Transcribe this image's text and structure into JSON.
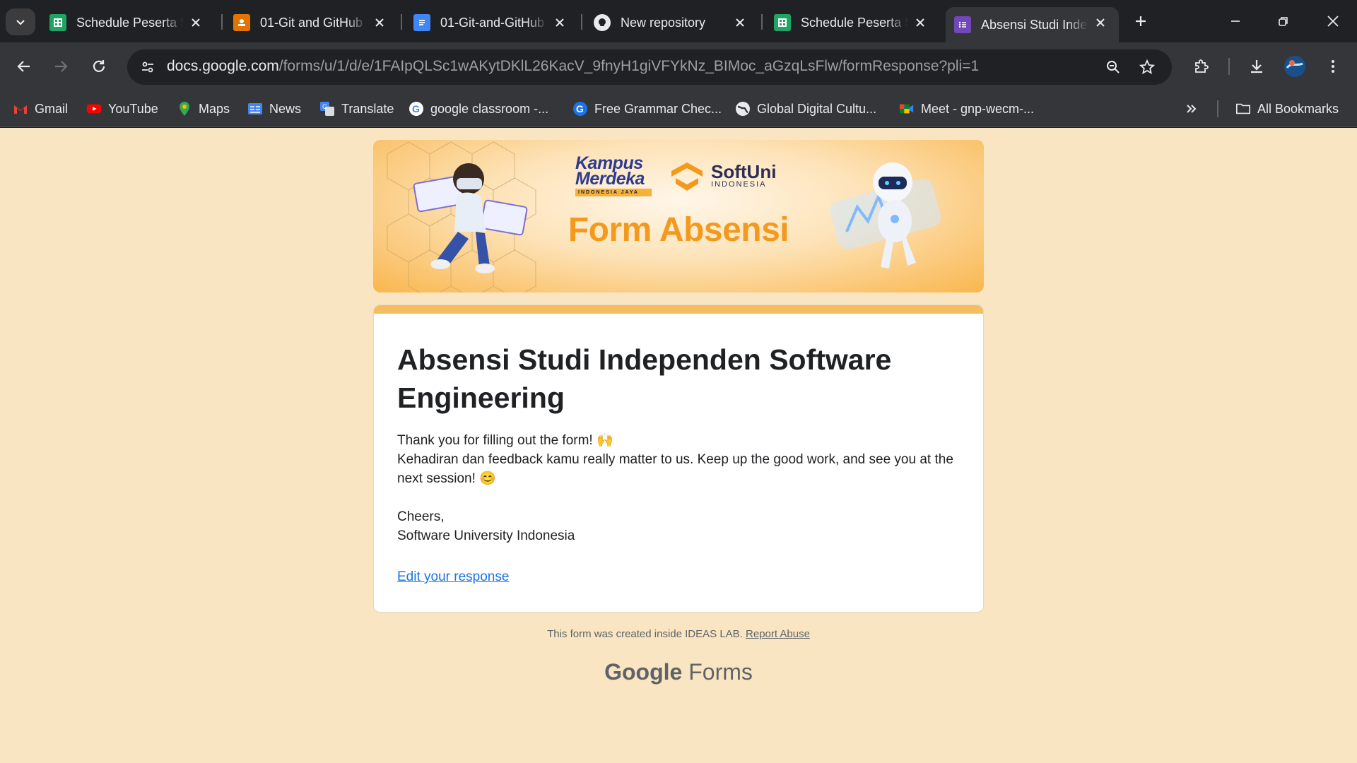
{
  "browser": {
    "tabs": [
      {
        "title": "Schedule Peserta Studi Independen",
        "icon": "sheets-icon",
        "active": false
      },
      {
        "title": "01-Git and GitHub",
        "icon": "slides-icon",
        "active": false
      },
      {
        "title": "01-Git-and-GitHub",
        "icon": "docs-icon",
        "active": false
      },
      {
        "title": "New repository",
        "icon": "github-icon",
        "active": false
      },
      {
        "title": "Schedule Peserta Studi Independen",
        "icon": "sheets-icon",
        "active": false
      },
      {
        "title": "Absensi Studi Independen",
        "icon": "forms-icon",
        "active": true
      }
    ],
    "url_host": "docs.google.com",
    "url_path": "/forms/u/1/d/e/1FAIpQLSc1wAKytDKlL26KacV_9fnyH1giVFYkNz_BIMoc_aGzqLsFlw/formResponse?pli=1",
    "bookmarks": [
      {
        "label": "Gmail",
        "icon": "gmail-icon"
      },
      {
        "label": "YouTube",
        "icon": "youtube-icon"
      },
      {
        "label": "Maps",
        "icon": "maps-icon"
      },
      {
        "label": "News",
        "icon": "news-icon"
      },
      {
        "label": "Translate",
        "icon": "translate-icon"
      },
      {
        "label": "google classroom -...",
        "icon": "google-icon"
      },
      {
        "label": "Free Grammar Chec...",
        "icon": "grammar-icon"
      },
      {
        "label": "Global Digital Cultu...",
        "icon": "globe-icon"
      },
      {
        "label": "Meet - gnp-wecm-...",
        "icon": "meet-icon"
      }
    ],
    "all_bookmarks": "All Bookmarks",
    "colors": {
      "sheets": "#1fa463",
      "slides": "#e37400",
      "docs": "#4285f4",
      "forms": "#7248b9"
    }
  },
  "banner": {
    "logo_kampus": "Kampus Merdeka",
    "logo_kampus_tag": "INDONESIA JAYA",
    "logo_softuni": "SoftUni",
    "logo_softuni_sub": "INDONESIA",
    "title": "Form Absensi"
  },
  "form": {
    "title": "Absensi Studi Independen Software Engineering",
    "line1": "Thank you for filling out the form! 🙌",
    "line2": "Kehadiran dan feedback kamu really matter to us. Keep up the good work, and see you at the next session! 😊",
    "line3": "Cheers,",
    "line4": "Software University Indonesia",
    "edit_link": "Edit your response"
  },
  "footer": {
    "created": "This form was created inside IDEAS LAB.",
    "report": "Report Abuse",
    "brand_google": "Google",
    "brand_forms": "Forms"
  },
  "page_colors": {
    "background": "#f9e5c2",
    "accent": "#f6bd5f",
    "link": "#1a73e8"
  }
}
